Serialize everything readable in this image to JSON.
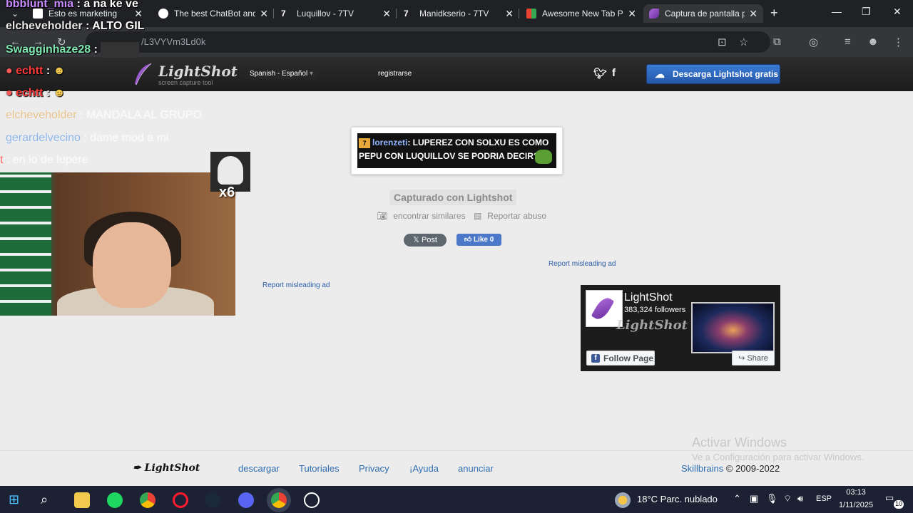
{
  "browser": {
    "tabs": [
      {
        "title": "Esto es marketing"
      },
      {
        "title": "The best ChatBot and"
      },
      {
        "title": "Luquillov - 7TV"
      },
      {
        "title": "Manidkserio - 7TV"
      },
      {
        "title": "Awesome New Tab P"
      },
      {
        "title": "Captura de pantalla p"
      }
    ],
    "new_tab": "+",
    "url": "/L3VYVm3Ld0k"
  },
  "lightshot": {
    "logo_name": "LightShot",
    "logo_tagline": "screen capture tool",
    "language": "Spanish - Español",
    "register": "registrarse",
    "download_button": "Descarga Lightshot gratis",
    "screenshot_user": "lorenzeti",
    "screenshot_text": ": LUPEREZ CON SOLXU ES COMO PEPU CON LUQUILLOV SE PODRIA DECIR?",
    "captured_with": "Capturado con Lightshot",
    "find_similar": "encontrar similares",
    "report_abuse": "Reportar abuso",
    "post_button": "Post",
    "like_button": "Like 0",
    "report_ad_1": "Report misleading ad",
    "report_ad_2": "Report misleading ad"
  },
  "fb_widget": {
    "page_name": "LightShot",
    "followers": "383,324 followers",
    "follow_button": "Follow Page",
    "share_button": "Share"
  },
  "activate_windows": {
    "title": "Activar Windows",
    "subtitle": "Ve a Configuración para activar Windows."
  },
  "footer": {
    "logo": "LightShot",
    "links": [
      "descargar",
      "Tutoriales",
      "Privacy",
      "¡Ayuda",
      "anunciar"
    ],
    "company": "Skillbrains",
    "years": "© 2009-2022"
  },
  "stream_chat": [
    {
      "user": "bbblunt_mia",
      "msg": ": a na ke ve"
    },
    {
      "user": "elcheveholder",
      "msg": ": ALTO GIL"
    },
    {
      "user": "Swagginhaze28",
      "msg": ":"
    },
    {
      "user": "echtt",
      "msg": ":"
    },
    {
      "user": "echtt",
      "msg": ":"
    },
    {
      "user": "elcheveholder",
      "msg": ": MANDALA AL GRUPO"
    },
    {
      "user": "gerardelvecino",
      "msg": ": dame mod a mi"
    },
    {
      "user": "t",
      "msg": ": en lo de lupere"
    }
  ],
  "emote_overlay": {
    "count": "x6"
  },
  "taskbar": {
    "weather": "18°C  Parc. nublado",
    "language": "ESP",
    "time": "03:13",
    "date": "1/11/2025",
    "notifications": "10"
  },
  "colors": {
    "accent_blue": "#2f6db0",
    "download_btn": "#2f66c0",
    "tab_bg": "#202124",
    "taskbar_bg": "#1c2233"
  }
}
